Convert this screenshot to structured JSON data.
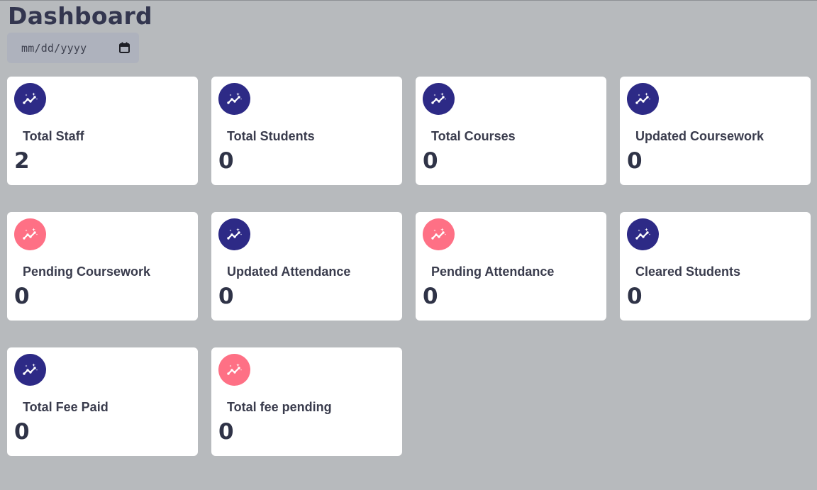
{
  "header": {
    "title": "Dashboard"
  },
  "date_filter": {
    "value": "mm/dd/yyyy",
    "icon": "calendar-icon"
  },
  "colors": {
    "positive": "#2d2a86",
    "negative": "#fe7085",
    "card_bg": "#ffffff",
    "page_bg": "#b7babd"
  },
  "cards": [
    {
      "label": "Total Staff",
      "value": "2",
      "icon": "trend-icon",
      "tone": "positive"
    },
    {
      "label": "Total Students",
      "value": "0",
      "icon": "trend-icon",
      "tone": "positive"
    },
    {
      "label": "Total Courses",
      "value": "0",
      "icon": "trend-icon",
      "tone": "positive"
    },
    {
      "label": "Updated Coursework",
      "value": "0",
      "icon": "trend-icon",
      "tone": "positive"
    },
    {
      "label": "Pending Coursework",
      "value": "0",
      "icon": "trend-icon",
      "tone": "negative"
    },
    {
      "label": "Updated Attendance",
      "value": "0",
      "icon": "trend-icon",
      "tone": "positive"
    },
    {
      "label": "Pending Attendance",
      "value": "0",
      "icon": "trend-icon",
      "tone": "negative"
    },
    {
      "label": "Cleared Students",
      "value": "0",
      "icon": "trend-icon",
      "tone": "positive"
    },
    {
      "label": "Total Fee Paid",
      "value": "0",
      "icon": "trend-icon",
      "tone": "positive"
    },
    {
      "label": "Total fee pending",
      "value": "0",
      "icon": "trend-icon",
      "tone": "negative"
    }
  ]
}
